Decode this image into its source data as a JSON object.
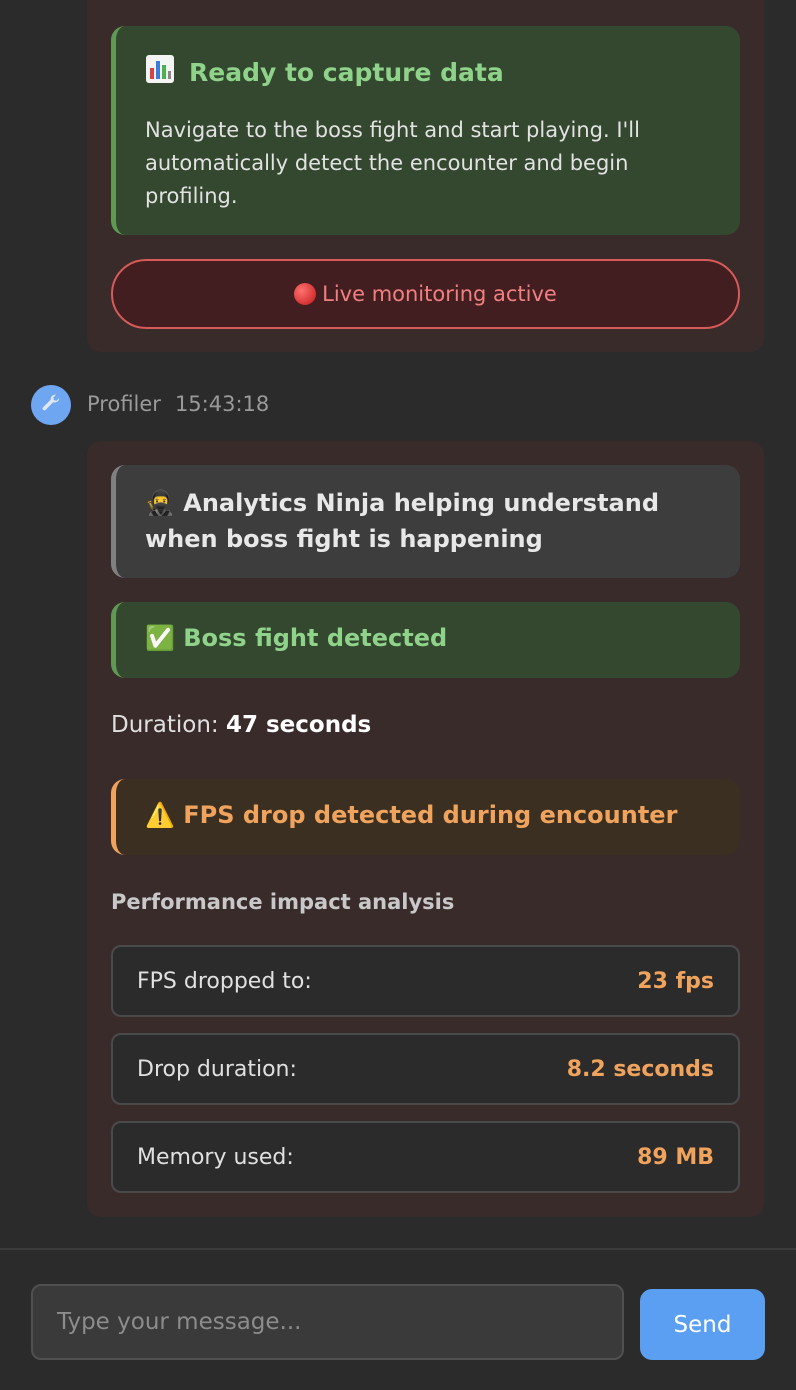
{
  "previous_message": {
    "ready_card": {
      "icon": "bar-chart-icon",
      "title": "Ready to capture data",
      "body": "Navigate to the boss fight and start playing. I'll automatically detect the encounter and begin profiling."
    },
    "live_button": {
      "icon": "red-circle-icon",
      "label": "Live monitoring active"
    }
  },
  "message": {
    "avatar_icon": "wrench-icon",
    "sender": "Profiler",
    "time": "15:43:18",
    "ninja_note": "🥷 Analytics Ninja helping understand when boss fight is happening",
    "detected": "✅ Boss fight detected",
    "duration": {
      "label": "Duration:",
      "value": "47 seconds"
    },
    "warning": "⚠️ FPS drop detected during encounter",
    "perf_title": "Performance impact analysis",
    "metrics": [
      {
        "label": "FPS dropped to:",
        "value": "23 fps"
      },
      {
        "label": "Drop duration:",
        "value": "8.2 seconds"
      },
      {
        "label": "Memory used:",
        "value": "89 MB"
      }
    ]
  },
  "composer": {
    "placeholder": "Type your message...",
    "value": "",
    "send_label": "Send"
  },
  "colors": {
    "background": "#2b2b2b",
    "bubble": "#3a2b2b",
    "success": "#8fd28a",
    "warning": "#f0a35c",
    "danger": "#d85a5a",
    "accent": "#5b9ff2"
  }
}
